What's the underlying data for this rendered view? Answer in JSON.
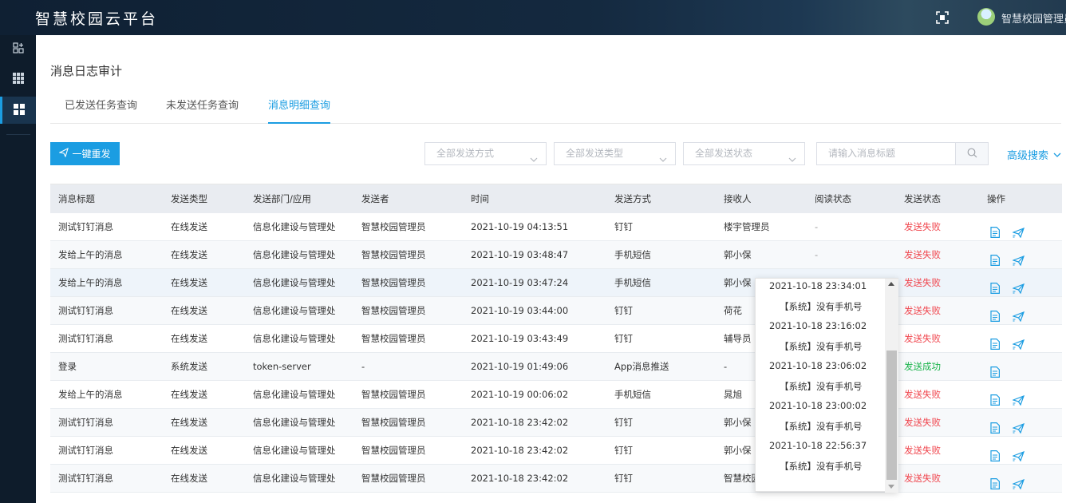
{
  "app": {
    "title": "智慧校园云平台",
    "user": "智慧校园管理员"
  },
  "page": {
    "title": "消息日志审计"
  },
  "tabs": [
    {
      "label": "已发送任务查询"
    },
    {
      "label": "未发送任务查询"
    },
    {
      "label": "消息明细查询",
      "active": true
    }
  ],
  "toolbar": {
    "resend_label": "一键重发",
    "filter_method": "全部发送方式",
    "filter_type": "全部发送类型",
    "filter_status": "全部发送状态",
    "search_placeholder": "请输入消息标题",
    "advanced_label": "高级搜索"
  },
  "colors": {
    "accent": "#1b9de2",
    "fail": "#f0444c",
    "success": "#19b34a"
  },
  "table": {
    "headers": [
      "消息标题",
      "发送类型",
      "发送部门/应用",
      "发送者",
      "时间",
      "发送方式",
      "接收人",
      "阅读状态",
      "发送状态",
      "操作"
    ],
    "rows": [
      {
        "title": "测试钉钉消息",
        "type": "在线发送",
        "dept": "信息化建设与管理处",
        "sender": "智慧校园管理员",
        "time": "2021-10-19 04:13:51",
        "method": "钉钉",
        "receiver": "楼宇管理员",
        "read": "-",
        "status": "发送失败"
      },
      {
        "title": "发给上午的消息",
        "type": "在线发送",
        "dept": "信息化建设与管理处",
        "sender": "智慧校园管理员",
        "time": "2021-10-19 03:48:47",
        "method": "手机短信",
        "receiver": "郭小保",
        "read": "-",
        "status": "发送失败"
      },
      {
        "title": "发给上午的消息",
        "type": "在线发送",
        "dept": "信息化建设与管理处",
        "sender": "智慧校园管理员",
        "time": "2021-10-19 03:47:24",
        "method": "手机短信",
        "receiver": "郭小保",
        "read": "",
        "status": "发送失败"
      },
      {
        "title": "测试钉钉消息",
        "type": "在线发送",
        "dept": "信息化建设与管理处",
        "sender": "智慧校园管理员",
        "time": "2021-10-19 03:44:00",
        "method": "钉钉",
        "receiver": "荷花",
        "read": "",
        "status": "发送失败"
      },
      {
        "title": "测试钉钉消息",
        "type": "在线发送",
        "dept": "信息化建设与管理处",
        "sender": "智慧校园管理员",
        "time": "2021-10-19 03:43:49",
        "method": "钉钉",
        "receiver": "辅导员",
        "read": "",
        "status": "发送失败"
      },
      {
        "title": "登录",
        "type": "系统发送",
        "dept": "token-server",
        "sender": "-",
        "time": "2021-10-19 01:49:06",
        "method": "App消息推送",
        "receiver": "-",
        "read": "",
        "status": "发送成功"
      },
      {
        "title": "发给上午的消息",
        "type": "在线发送",
        "dept": "信息化建设与管理处",
        "sender": "智慧校园管理员",
        "time": "2021-10-19 00:06:02",
        "method": "手机短信",
        "receiver": "晁旭",
        "read": "",
        "status": "发送失败"
      },
      {
        "title": "测试钉钉消息",
        "type": "在线发送",
        "dept": "信息化建设与管理处",
        "sender": "智慧校园管理员",
        "time": "2021-10-18 23:42:02",
        "method": "钉钉",
        "receiver": "郭小保",
        "read": "",
        "status": "发送失败"
      },
      {
        "title": "测试钉钉消息",
        "type": "在线发送",
        "dept": "信息化建设与管理处",
        "sender": "智慧校园管理员",
        "time": "2021-10-18 23:42:02",
        "method": "钉钉",
        "receiver": "郭小保",
        "read": "",
        "status": "发送失败"
      },
      {
        "title": "测试钉钉消息",
        "type": "在线发送",
        "dept": "信息化建设与管理处",
        "sender": "智慧校园管理员",
        "time": "2021-10-18 23:42:02",
        "method": "钉钉",
        "receiver": "智慧校园",
        "read": "",
        "status": "发送失败"
      }
    ]
  },
  "popup": {
    "items": [
      {
        "time": "2021-10-18 23:34:01",
        "msg": "【系统】没有手机号"
      },
      {
        "time": "2021-10-18 23:16:02",
        "msg": "【系统】没有手机号"
      },
      {
        "time": "2021-10-18 23:06:02",
        "msg": "【系统】没有手机号"
      },
      {
        "time": "2021-10-18 23:00:02",
        "msg": "【系统】没有手机号"
      },
      {
        "time": "2021-10-18 22:56:37",
        "msg": "【系统】没有手机号"
      }
    ]
  }
}
